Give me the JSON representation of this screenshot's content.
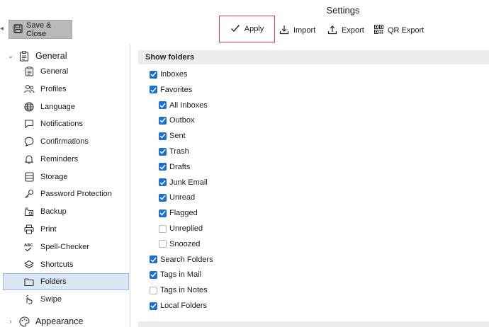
{
  "window": {
    "title": "Settings"
  },
  "toolbar": {
    "save_close_label": "Save & Close",
    "apply_label": "Apply",
    "import_label": "Import",
    "export_label": "Export",
    "qr_export_label": "QR Export",
    "highlight_color": "#e23b3b"
  },
  "sidebar": {
    "groups": [
      {
        "label": "General",
        "expanded": true,
        "icon": "clipboard-icon"
      },
      {
        "label": "Appearance",
        "expanded": false,
        "icon": "palette-icon"
      }
    ],
    "items": [
      {
        "label": "General",
        "icon": "clipboard-icon"
      },
      {
        "label": "Profiles",
        "icon": "profiles-icon"
      },
      {
        "label": "Language",
        "icon": "globe-icon"
      },
      {
        "label": "Notifications",
        "icon": "chat-bubble-icon"
      },
      {
        "label": "Confirmations",
        "icon": "confirm-bubble-icon"
      },
      {
        "label": "Reminders",
        "icon": "bell-icon"
      },
      {
        "label": "Storage",
        "icon": "storage-icon"
      },
      {
        "label": "Password Protection",
        "icon": "key-icon"
      },
      {
        "label": "Backup",
        "icon": "backup-icon"
      },
      {
        "label": "Print",
        "icon": "printer-icon"
      },
      {
        "label": "Spell-Checker",
        "icon": "spellcheck-icon"
      },
      {
        "label": "Shortcuts",
        "icon": "layers-icon"
      },
      {
        "label": "Folders",
        "icon": "folder-icon",
        "selected": true
      },
      {
        "label": "Swipe",
        "icon": "swipe-icon"
      }
    ],
    "selected_color": "#dbe7f5"
  },
  "main": {
    "section_title": "Show folders",
    "options": [
      {
        "label": "Inboxes",
        "checked": true,
        "level": 0
      },
      {
        "label": "Favorites",
        "checked": true,
        "level": 0
      },
      {
        "label": "All Inboxes",
        "checked": true,
        "level": 1
      },
      {
        "label": "Outbox",
        "checked": true,
        "level": 1
      },
      {
        "label": "Sent",
        "checked": true,
        "level": 1
      },
      {
        "label": "Trash",
        "checked": true,
        "level": 1
      },
      {
        "label": "Drafts",
        "checked": true,
        "level": 1
      },
      {
        "label": "Junk Email",
        "checked": true,
        "level": 1
      },
      {
        "label": "Unread",
        "checked": true,
        "level": 1
      },
      {
        "label": "Flagged",
        "checked": true,
        "level": 1
      },
      {
        "label": "Unreplied",
        "checked": false,
        "level": 1
      },
      {
        "label": "Snoozed",
        "checked": false,
        "level": 1
      },
      {
        "label": "Search Folders",
        "checked": true,
        "level": 0
      },
      {
        "label": "Tags in Mail",
        "checked": true,
        "level": 0
      },
      {
        "label": "Tags in Notes",
        "checked": false,
        "level": 0
      },
      {
        "label": "Local Folders",
        "checked": true,
        "level": 0
      }
    ],
    "checkbox_color": "#1f6fcf"
  }
}
